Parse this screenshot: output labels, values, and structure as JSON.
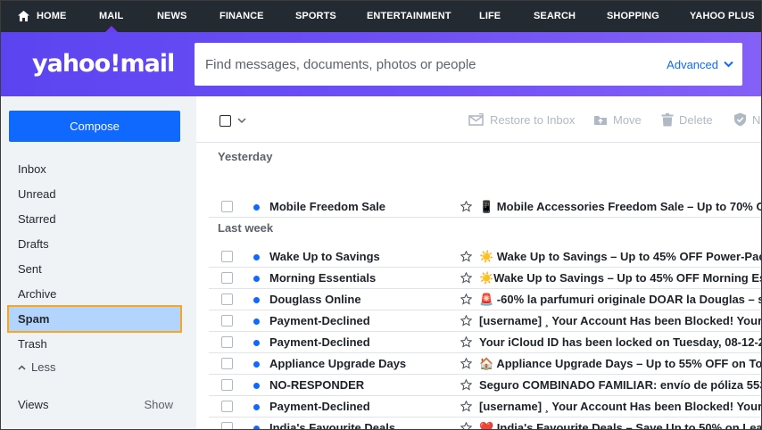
{
  "topnav": {
    "items": [
      "HOME",
      "MAIL",
      "NEWS",
      "FINANCE",
      "SPORTS",
      "ENTERTAINMENT",
      "LIFE",
      "SEARCH",
      "SHOPPING",
      "YAHOO PLUS"
    ],
    "active": "MAIL"
  },
  "header": {
    "logo": "yahoo!mail",
    "search_placeholder": "Find messages, documents, photos or people",
    "advanced_label": "Advanced"
  },
  "sidebar": {
    "compose_label": "Compose",
    "folders": [
      "Inbox",
      "Unread",
      "Starred",
      "Drafts",
      "Sent",
      "Archive",
      "Spam",
      "Trash"
    ],
    "active_folder": "Spam",
    "less_label": "Less",
    "views_label": "Views",
    "show_label": "Show"
  },
  "toolbar": {
    "restore_label": "Restore to Inbox",
    "move_label": "Move",
    "delete_label": "Delete",
    "not_spam_label": "N"
  },
  "groups": {
    "yesterday": "Yesterday",
    "last_week": "Last week"
  },
  "messages": [
    {
      "sender": "Mobile Freedom Sale",
      "subject": "📱 Mobile Accessories Freedom Sale – Up to 70% O"
    },
    {
      "sender": "Wake Up to Savings",
      "subject": "☀️ Wake Up to Savings – Up to 45% OFF Power-Pac"
    },
    {
      "sender": "Morning Essentials",
      "subject": "☀️Wake Up to Savings – Up to 45% OFF Morning Es"
    },
    {
      "sender": "Douglass Online",
      "subject": "🚨 -60% la parfumuri originale DOAR la Douglas – s"
    },
    {
      "sender": "Payment-Declined",
      "subject": "[username] ¸ Your Account Has been Blocked! Your"
    },
    {
      "sender": "Payment-Declined",
      "subject": "Your iCloud ID has been locked on Tuesday, 08-12-2"
    },
    {
      "sender": "Appliance Upgrade Days",
      "subject": "🏠 Appliance Upgrade Days – Up to 55% OFF on To"
    },
    {
      "sender": "NO-RESPONDER",
      "subject": "Seguro COMBINADO FAMILIAR: envío de póliza 553"
    },
    {
      "sender": "Payment-Declined",
      "subject": "[username] ¸ Your Account Has been Blocked! Your"
    },
    {
      "sender": "India's Favourite Deals",
      "subject": "❤️ India's Favourite Deals – Save Up to 50% on Lea"
    }
  ],
  "colors": {
    "nav_bg": "#232a31",
    "header_purple": "#6e3bf3",
    "accent_blue": "#0f69ff",
    "sidebar_bg": "#f0f3f5",
    "spam_highlight": "#b3d4fc",
    "focus_border": "#f5a623"
  }
}
